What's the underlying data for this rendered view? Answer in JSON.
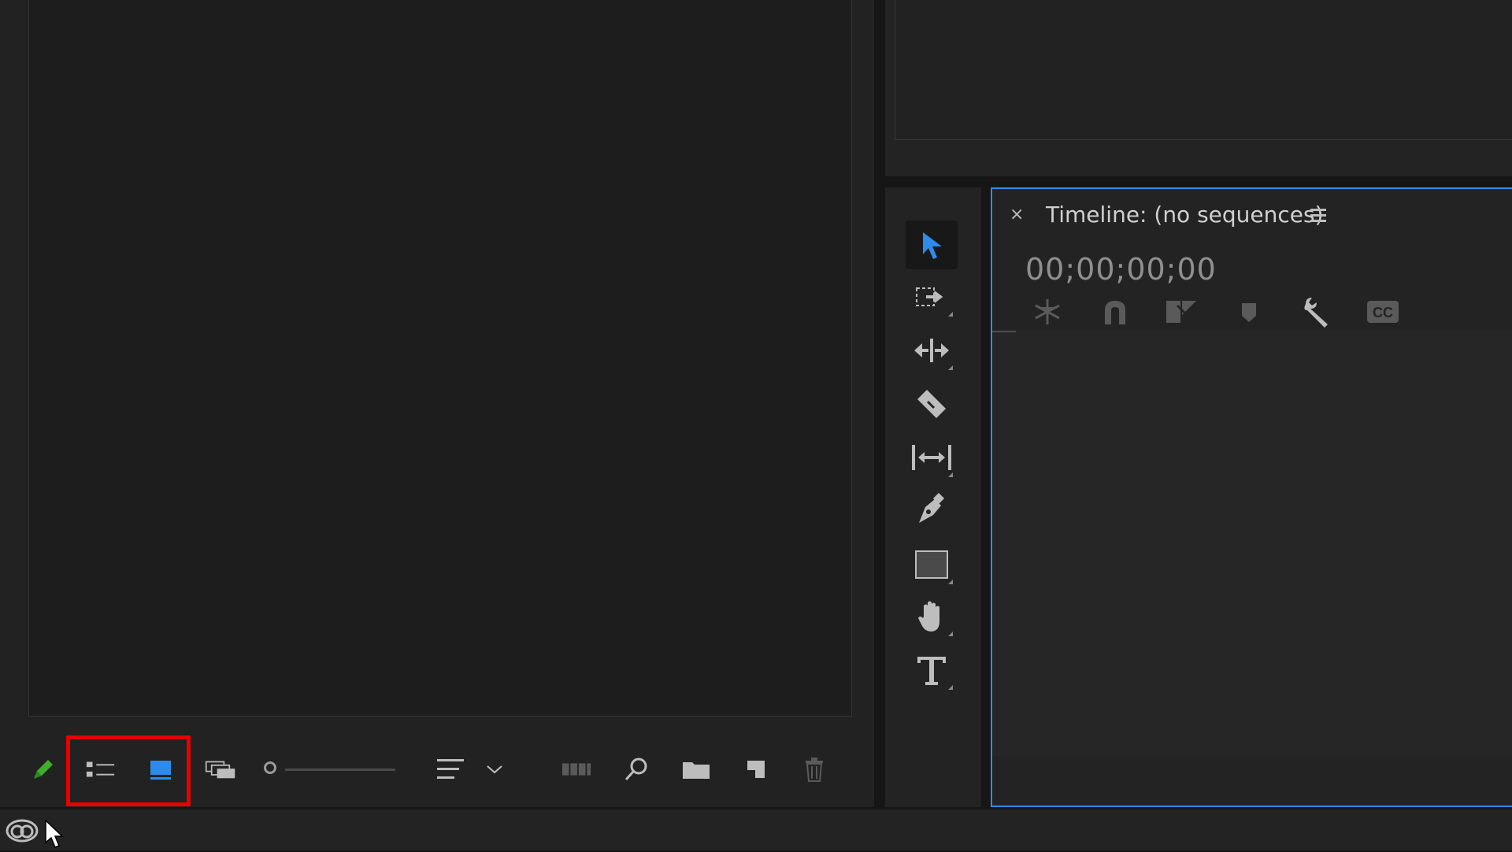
{
  "timeline": {
    "close_glyph": "×",
    "title": "Timeline: (no sequences)",
    "timecode": "00;00;00;00"
  },
  "colors": {
    "accent_blue": "#2d8ceb",
    "highlight_red": "#e60000",
    "pencil_green": "#3fae2a"
  },
  "project_toolbar": {
    "icons": [
      "pencil-icon",
      "list-view-icon",
      "icon-view-icon",
      "freeform-view-icon",
      "zoom-slider",
      "sort-icon",
      "sort-dropdown-icon",
      "automate-to-sequence-icon",
      "find-icon",
      "new-bin-icon",
      "new-item-icon",
      "clear-icon"
    ]
  },
  "tools": [
    "selection-tool",
    "track-select-tool",
    "ripple-edit-tool",
    "razor-tool",
    "slip-tool",
    "pen-tool",
    "rectangle-tool",
    "hand-tool",
    "type-tool"
  ],
  "timeline_tools": [
    "insert-nest-icon",
    "snap-icon",
    "linked-selection-icon",
    "add-marker-icon",
    "timeline-settings-icon",
    "captions-icon"
  ]
}
